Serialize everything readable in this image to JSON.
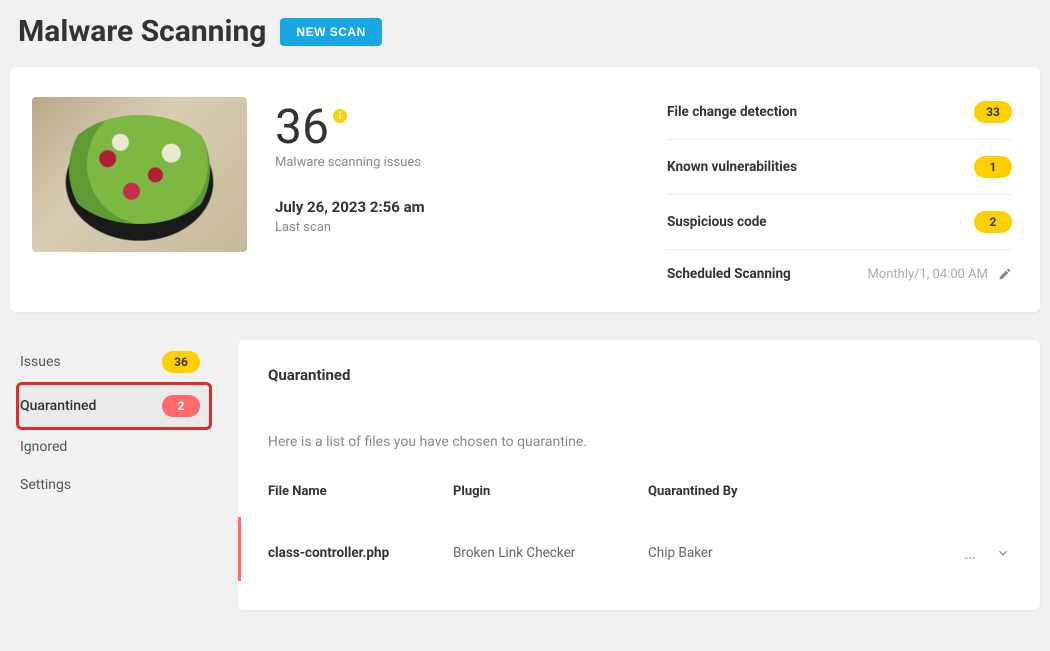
{
  "header": {
    "title": "Malware Scanning",
    "new_scan_label": "NEW SCAN"
  },
  "summary": {
    "issue_count": "36",
    "issue_label": "Malware scanning issues",
    "last_scan_time": "July 26, 2023 2:56 am",
    "last_scan_label": "Last scan"
  },
  "stats": {
    "file_change": {
      "label": "File change detection",
      "count": "33"
    },
    "known_vuln": {
      "label": "Known vulnerabilities",
      "count": "1"
    },
    "suspicious": {
      "label": "Suspicious code",
      "count": "2"
    },
    "scheduled": {
      "label": "Scheduled Scanning",
      "value": "Monthly/1, 04:00 AM"
    }
  },
  "sidebar": {
    "issues": {
      "label": "Issues",
      "count": "36"
    },
    "quarantined": {
      "label": "Quarantined",
      "count": "2"
    },
    "ignored": {
      "label": "Ignored"
    },
    "settings": {
      "label": "Settings"
    }
  },
  "quarantine": {
    "title": "Quarantined",
    "description": "Here is a list of files you have chosen to quarantine.",
    "columns": {
      "file": "File Name",
      "plugin": "Plugin",
      "by": "Quarantined By"
    },
    "rows": [
      {
        "file": "class-controller.php",
        "plugin": "Broken Link Checker",
        "by": "Chip Baker"
      }
    ]
  }
}
